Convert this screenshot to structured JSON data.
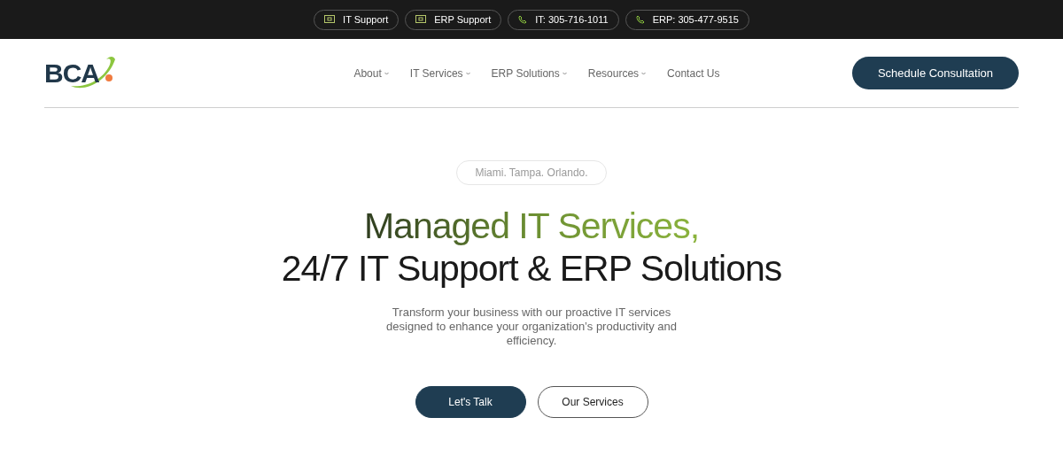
{
  "top_bar": [
    {
      "kind": "monitor",
      "label": "IT Support"
    },
    {
      "kind": "monitor",
      "label": "ERP Support"
    },
    {
      "kind": "phone",
      "label": "IT: 305-716-1011"
    },
    {
      "kind": "phone",
      "label": "ERP: 305-477-9515"
    }
  ],
  "logo": {
    "text": "BCA"
  },
  "nav": [
    {
      "label": "About",
      "dropdown": true
    },
    {
      "label": "IT Services",
      "dropdown": true
    },
    {
      "label": "ERP Solutions",
      "dropdown": true
    },
    {
      "label": "Resources",
      "dropdown": true
    },
    {
      "label": "Contact Us",
      "dropdown": false
    }
  ],
  "header_button": "Schedule Consultation",
  "hero": {
    "badge": "Miami. Tampa. Orlando.",
    "headline_line_1": "Managed IT Services,",
    "headline_line_2": "24/7 IT Support & ERP Solutions",
    "description": "Transform your business with our proactive IT services designed to enhance your organization’s productivity and efficiency.",
    "buttons": [
      {
        "label": "Let's Talk",
        "kind": "primary"
      },
      {
        "label": "Our Services",
        "kind": "outline"
      }
    ]
  }
}
